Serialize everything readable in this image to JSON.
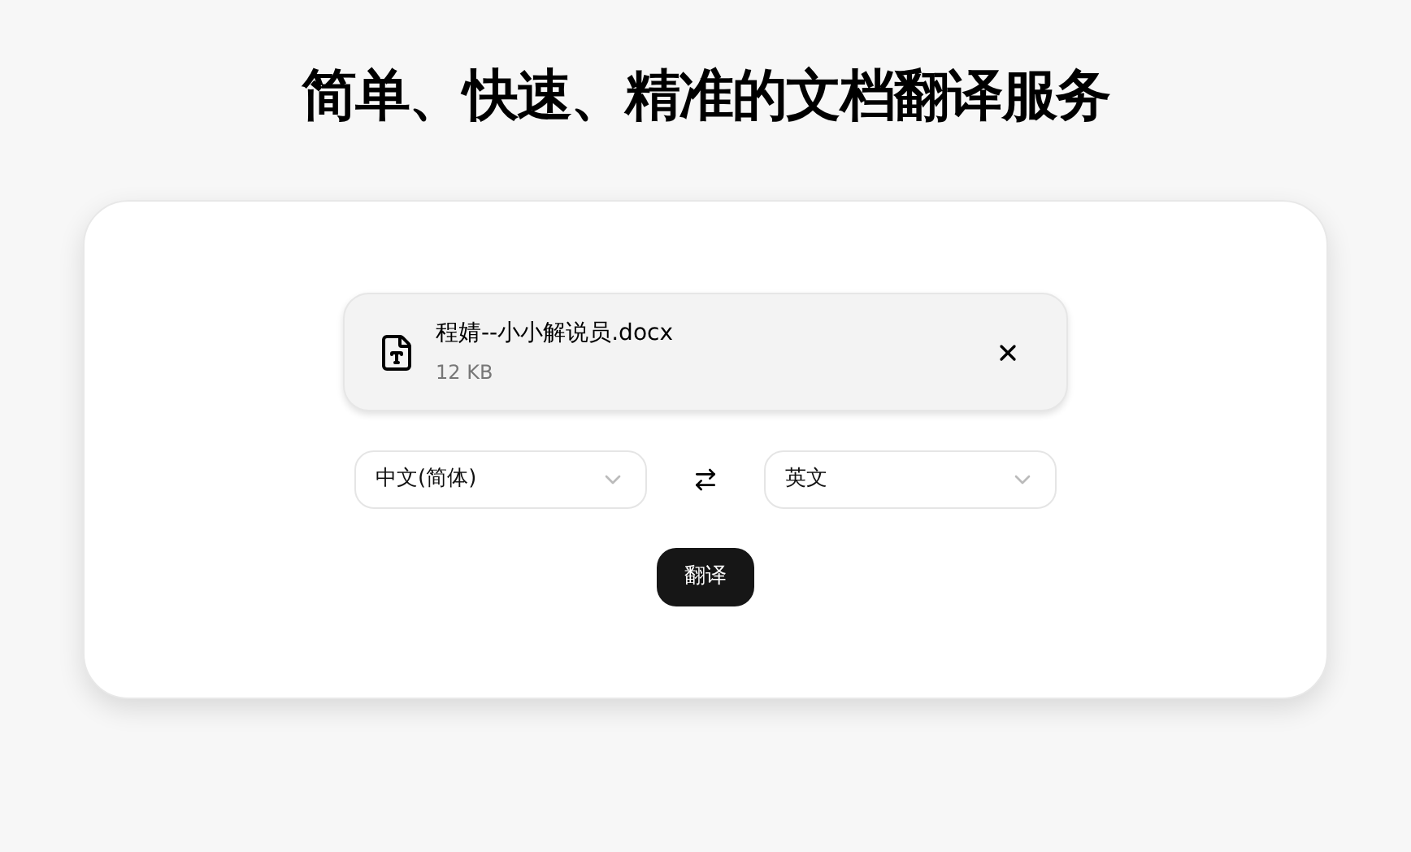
{
  "title": "简单、快速、精准的文档翻译服务",
  "file": {
    "name": "程婧--小小解说员.docx",
    "size": "12 KB"
  },
  "source_language": {
    "value": "中文(简体)"
  },
  "target_language": {
    "value": "英文"
  },
  "translate_button": "翻译"
}
